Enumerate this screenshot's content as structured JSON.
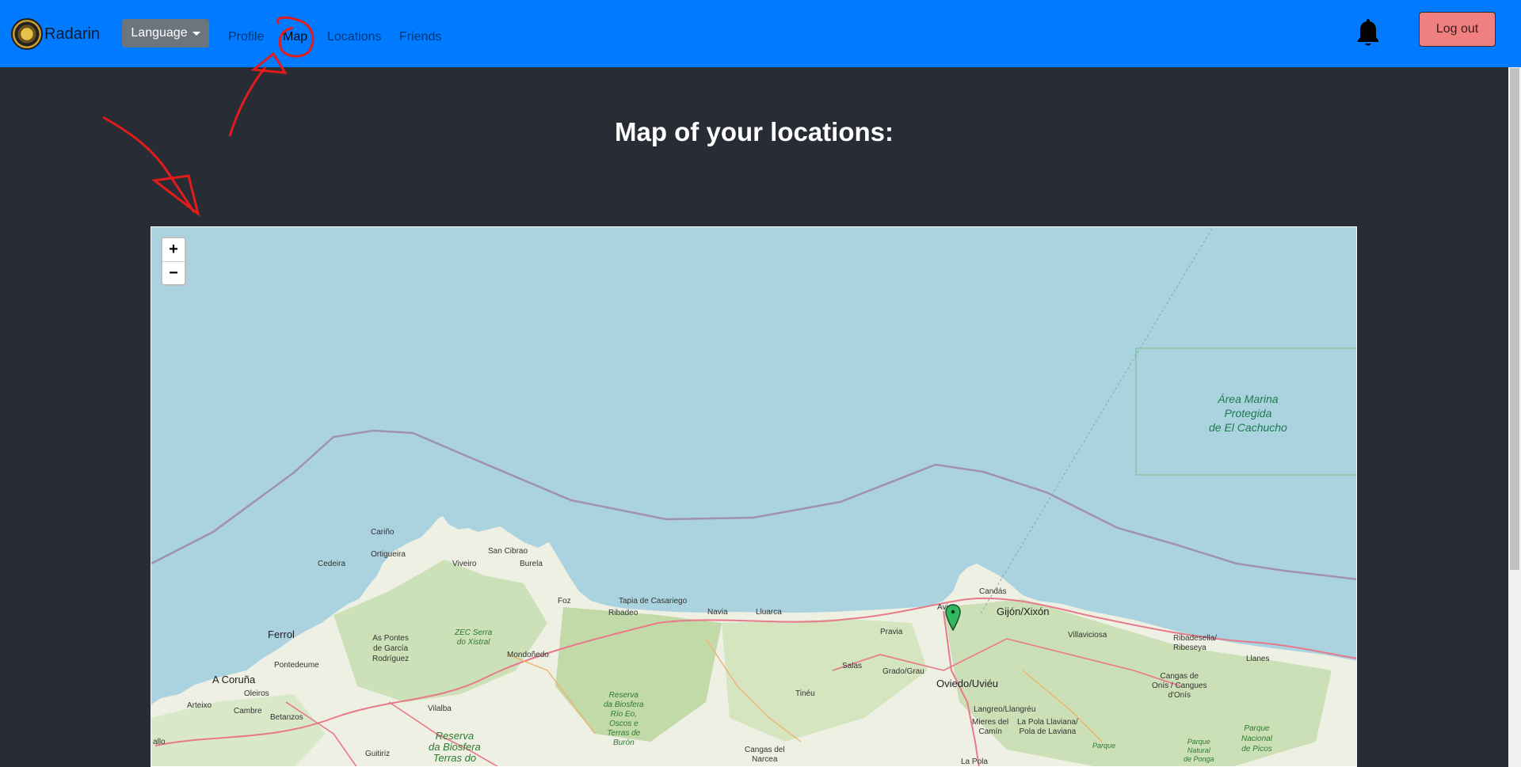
{
  "navbar": {
    "brand": "Radarin",
    "language_label": "Language",
    "links": [
      "Profile",
      "Map",
      "Locations",
      "Friends"
    ],
    "active_link": "Map",
    "logout_label": "Log out"
  },
  "main": {
    "title": "Map of your locations:"
  },
  "map": {
    "zoom_in": "+",
    "zoom_out": "−",
    "marine_area": "Área Marina\nProtegida\nde El Cachucho",
    "places": {
      "carino": "Cariño",
      "ortigueira": "Ortigueira",
      "cedeira": "Cedeira",
      "viveiro": "Viveiro",
      "san_cibrao": "San Cibrao",
      "burela": "Burela",
      "foz": "Foz",
      "tapia": "Tapia de Casariego",
      "ribadeo": "Ribadeo",
      "navia": "Navia",
      "luarca": "Lluarca",
      "pravia": "Pravia",
      "aviles": "Avi",
      "candas": "Candás",
      "gijon": "Gijón/Xixón",
      "villaviciosa": "Villaviciosa",
      "ribadesella": "Ribadesella/\nRibeseya",
      "llanes": "Llanes",
      "ferrol": "Ferrol",
      "as_pontes": "As Pontes\nde García\nRodríguez",
      "zec_serra": "ZEC Serra\ndo Xistral",
      "mondonedo": "Mondoñedo",
      "pontedeume": "Pontedeume",
      "a_coruna": "A Coruña",
      "oleiros": "Oleiros",
      "arteixo": "Arteixo",
      "cambre": "Cambre",
      "betanzos": "Betanzos",
      "vilalba": "Vilalba",
      "reserva_oscos": "Reserva\nda Biosfera\nRío Eo,\nOscos e\nTerras de\nBurón",
      "salas": "Salas",
      "grado": "Grado/Grau",
      "oviedo": "Oviedo/Uviéu",
      "tineu": "Tinéu",
      "langreo": "Langreo/Llangréu",
      "mieres": "Mieres del\nCamín",
      "pola_laviana": "La Pola Llaviana/\nPola de Laviana",
      "cangas_onis": "Cangas de\nOnís / Cangues\nd'Onís",
      "cangas_narcea": "Cangas del\nNarcea",
      "parque_picos": "Parque\nNacional\nde Picos",
      "parque_ponga": "Parque\nNatural\nde Ponga",
      "parque_generic": "Parque",
      "reserva_terras": "Reserva\nda Biosfera\nTerras do",
      "guitiriz": "Guitiriz",
      "la_pola": "La Pola",
      "allo": "allo"
    }
  }
}
